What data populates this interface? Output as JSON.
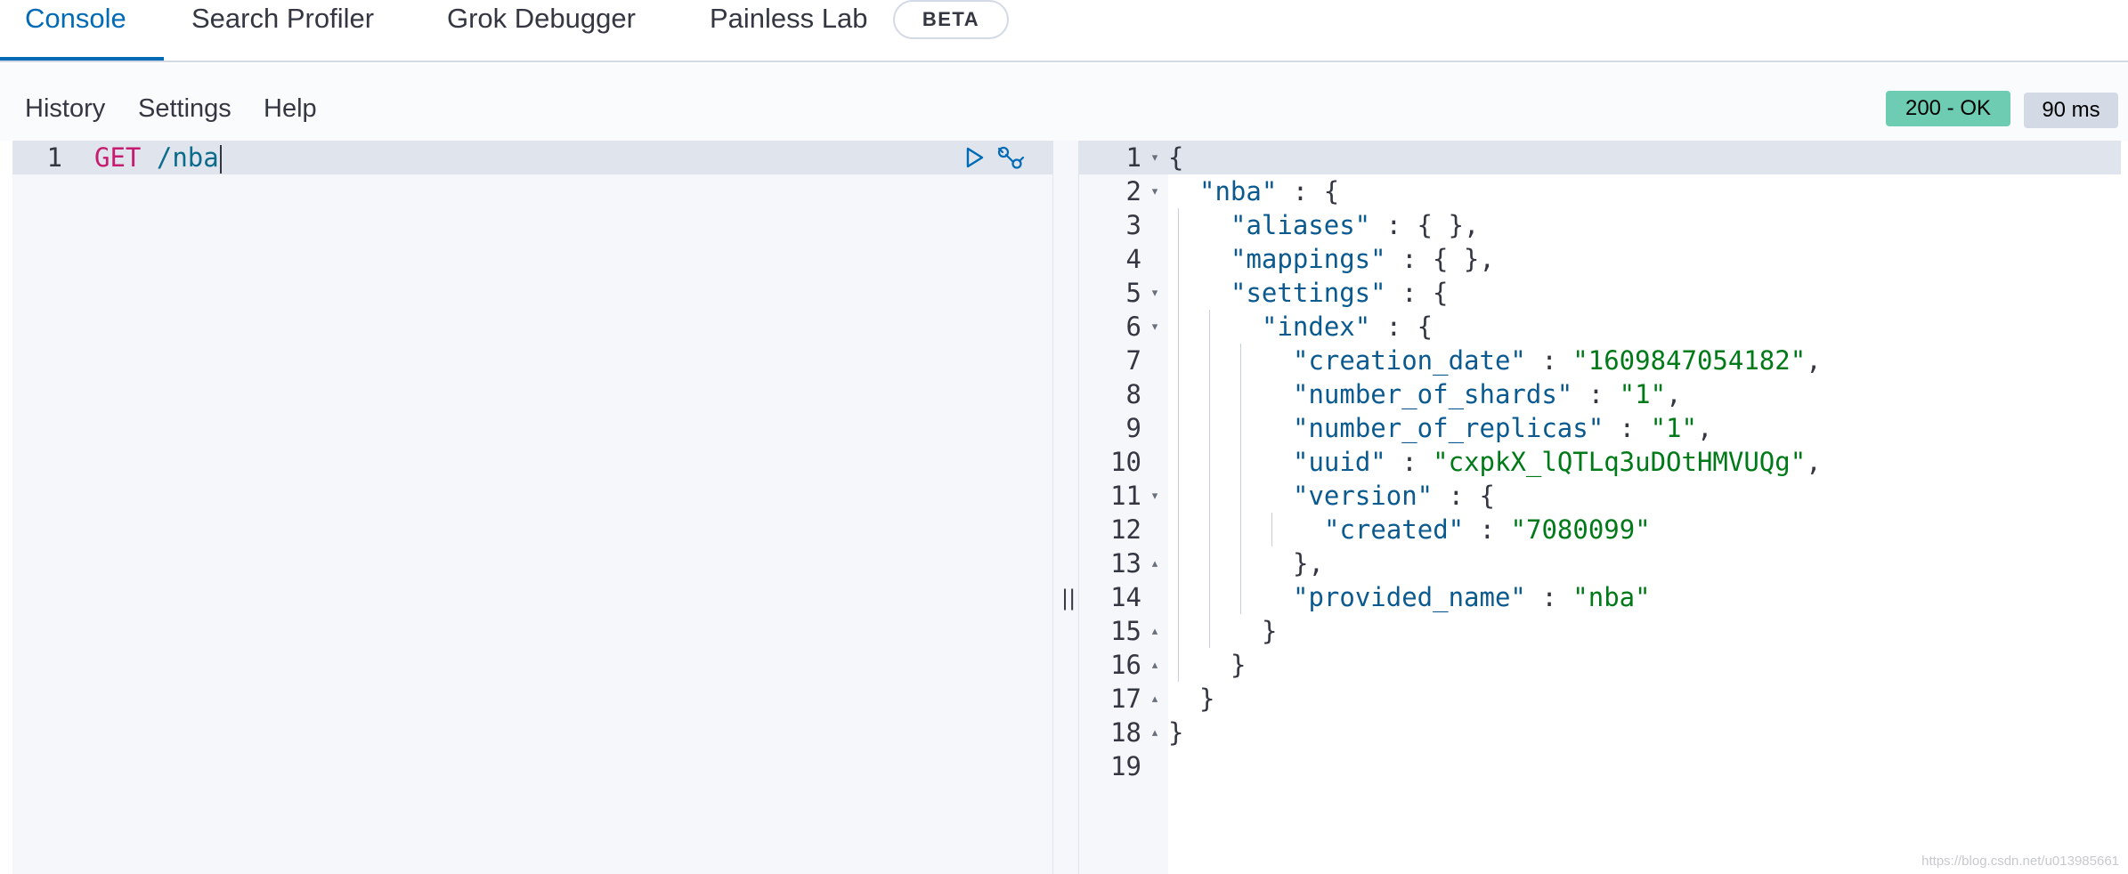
{
  "tabs": [
    {
      "label": "Console",
      "active": true
    },
    {
      "label": "Search Profiler",
      "active": false
    },
    {
      "label": "Grok Debugger",
      "active": false
    },
    {
      "label": "Painless Lab",
      "active": false
    }
  ],
  "beta_badge": "BETA",
  "toolbar": {
    "history": "History",
    "settings": "Settings",
    "help": "Help",
    "status": "200 - OK",
    "time": "90 ms"
  },
  "request_editor": {
    "line_number": "1",
    "method": "GET",
    "path": "/nba",
    "icons": [
      "play-icon",
      "wrench-icon"
    ]
  },
  "response_editor": {
    "lines": [
      {
        "n": "1",
        "fold": "down",
        "depth": 0,
        "parts": [
          {
            "t": "p",
            "v": "{"
          }
        ]
      },
      {
        "n": "2",
        "fold": "down",
        "depth": 1,
        "parts": [
          {
            "t": "k",
            "v": "\"nba\""
          },
          {
            "t": "p",
            "v": " : {"
          }
        ]
      },
      {
        "n": "3",
        "fold": "",
        "depth": 2,
        "parts": [
          {
            "t": "k",
            "v": "\"aliases\""
          },
          {
            "t": "p",
            "v": " : { },"
          }
        ]
      },
      {
        "n": "4",
        "fold": "",
        "depth": 2,
        "parts": [
          {
            "t": "k",
            "v": "\"mappings\""
          },
          {
            "t": "p",
            "v": " : { },"
          }
        ]
      },
      {
        "n": "5",
        "fold": "down",
        "depth": 2,
        "parts": [
          {
            "t": "k",
            "v": "\"settings\""
          },
          {
            "t": "p",
            "v": " : {"
          }
        ]
      },
      {
        "n": "6",
        "fold": "down",
        "depth": 3,
        "parts": [
          {
            "t": "k",
            "v": "\"index\""
          },
          {
            "t": "p",
            "v": " : {"
          }
        ]
      },
      {
        "n": "7",
        "fold": "",
        "depth": 4,
        "parts": [
          {
            "t": "k",
            "v": "\"creation_date\""
          },
          {
            "t": "p",
            "v": " : "
          },
          {
            "t": "s",
            "v": "\"1609847054182\""
          },
          {
            "t": "p",
            "v": ","
          }
        ]
      },
      {
        "n": "8",
        "fold": "",
        "depth": 4,
        "parts": [
          {
            "t": "k",
            "v": "\"number_of_shards\""
          },
          {
            "t": "p",
            "v": " : "
          },
          {
            "t": "s",
            "v": "\"1\""
          },
          {
            "t": "p",
            "v": ","
          }
        ]
      },
      {
        "n": "9",
        "fold": "",
        "depth": 4,
        "parts": [
          {
            "t": "k",
            "v": "\"number_of_replicas\""
          },
          {
            "t": "p",
            "v": " : "
          },
          {
            "t": "s",
            "v": "\"1\""
          },
          {
            "t": "p",
            "v": ","
          }
        ]
      },
      {
        "n": "10",
        "fold": "",
        "depth": 4,
        "parts": [
          {
            "t": "k",
            "v": "\"uuid\""
          },
          {
            "t": "p",
            "v": " : "
          },
          {
            "t": "s",
            "v": "\"cxpkX_lQTLq3uDOtHMVUQg\""
          },
          {
            "t": "p",
            "v": ","
          }
        ]
      },
      {
        "n": "11",
        "fold": "down",
        "depth": 4,
        "parts": [
          {
            "t": "k",
            "v": "\"version\""
          },
          {
            "t": "p",
            "v": " : {"
          }
        ]
      },
      {
        "n": "12",
        "fold": "",
        "depth": 5,
        "parts": [
          {
            "t": "k",
            "v": "\"created\""
          },
          {
            "t": "p",
            "v": " : "
          },
          {
            "t": "s",
            "v": "\"7080099\""
          }
        ]
      },
      {
        "n": "13",
        "fold": "up",
        "depth": 4,
        "parts": [
          {
            "t": "p",
            "v": "},"
          }
        ]
      },
      {
        "n": "14",
        "fold": "",
        "depth": 4,
        "parts": [
          {
            "t": "k",
            "v": "\"provided_name\""
          },
          {
            "t": "p",
            "v": " : "
          },
          {
            "t": "s",
            "v": "\"nba\""
          }
        ]
      },
      {
        "n": "15",
        "fold": "up",
        "depth": 3,
        "parts": [
          {
            "t": "p",
            "v": "}"
          }
        ]
      },
      {
        "n": "16",
        "fold": "up",
        "depth": 2,
        "parts": [
          {
            "t": "p",
            "v": "}"
          }
        ]
      },
      {
        "n": "17",
        "fold": "up",
        "depth": 1,
        "parts": [
          {
            "t": "p",
            "v": "}"
          }
        ]
      },
      {
        "n": "18",
        "fold": "up",
        "depth": 0,
        "parts": [
          {
            "t": "p",
            "v": "}"
          }
        ]
      },
      {
        "n": "19",
        "fold": "",
        "depth": 0,
        "parts": []
      }
    ]
  },
  "splitter_glyph": "||",
  "watermark": "https://blog.csdn.net/u013985661",
  "colors": {
    "accent": "#006bb4",
    "status_ok": "#6dccb1",
    "json_key": "#0b5a8f",
    "json_string": "#007a18",
    "method": "#c61d70"
  }
}
